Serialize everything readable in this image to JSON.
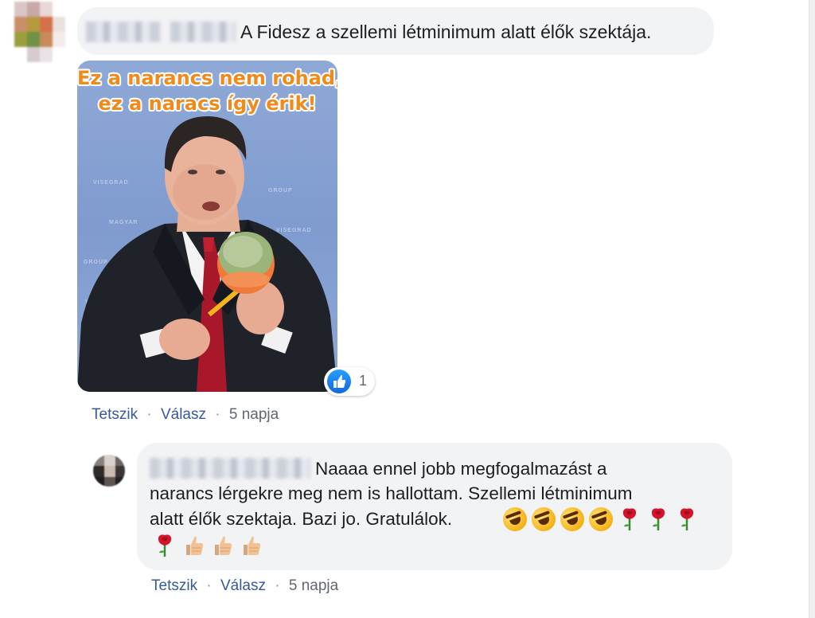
{
  "comment1": {
    "text": "A Fidesz a szellemi létminimum alatt élők szektája.",
    "meme_caption_line1": "Ez a narancs nem rohad,",
    "meme_caption_line2": "ez a naracs így érik!",
    "reaction_count": "1",
    "actions": {
      "like": "Tetszik",
      "reply": "Válasz",
      "separator": "·",
      "time": "5 napja"
    }
  },
  "comment2": {
    "line1": "Naaaa ennel jobb megfogalmazást a",
    "line2": "narancs lérgekre meg nem is hallottam. Szellemi létminimum",
    "line3": "alatt élők szektaja. Bazi jo. Gratulálok.",
    "emojis": [
      "rofl-emoji",
      "rofl-emoji",
      "rofl-emoji",
      "rofl-emoji",
      "rose-emoji",
      "rose-emoji",
      "rose-emoji",
      "rose-emoji",
      "thumbs-up-emoji",
      "thumbs-up-emoji",
      "thumbs-up-emoji"
    ],
    "actions": {
      "like": "Tetszik",
      "reply": "Válasz",
      "separator": "·",
      "time": "5 napja"
    }
  },
  "colors": {
    "link": "#385898",
    "bubble": "#f2f3f5",
    "like_blue": "#1877f2",
    "meme_caption": "#f08a18"
  }
}
